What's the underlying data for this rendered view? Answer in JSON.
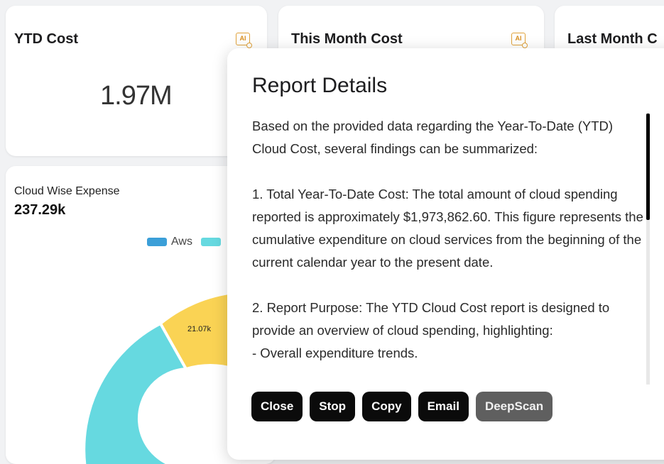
{
  "cards": {
    "ytd": {
      "title": "YTD Cost",
      "ai_label": "AI",
      "value": "1.97M"
    },
    "this_month": {
      "title": "This Month Cost",
      "ai_label": "AI"
    },
    "last_month": {
      "title": "Last Month C"
    }
  },
  "expense": {
    "title": "Cloud Wise Expense",
    "value": "237.29k",
    "legend": [
      {
        "label": "Aws",
        "color": "#3b9fd8"
      },
      {
        "label": "",
        "color": "#66d9e0"
      }
    ],
    "slice_label": "21.07k",
    "colors": {
      "yellow": "#fad354",
      "teal": "#66d9e0"
    }
  },
  "modal": {
    "title": "Report Details",
    "paragraphs": [
      "Based on the provided data regarding the Year-To-Date (YTD) Cloud Cost, several findings can be summarized:",
      "1. Total Year-To-Date Cost: The total amount of cloud spending reported is approximately $1,973,862.60. This figure represents the cumulative expenditure on cloud services from the beginning of the current calendar year to the present date.",
      "2. Report Purpose: The YTD Cloud Cost report is designed to provide an overview of cloud spending, highlighting:\n- Overall expenditure trends."
    ],
    "buttons": {
      "close": "Close",
      "stop": "Stop",
      "copy": "Copy",
      "email": "Email",
      "deepscan": "DeepScan"
    }
  }
}
